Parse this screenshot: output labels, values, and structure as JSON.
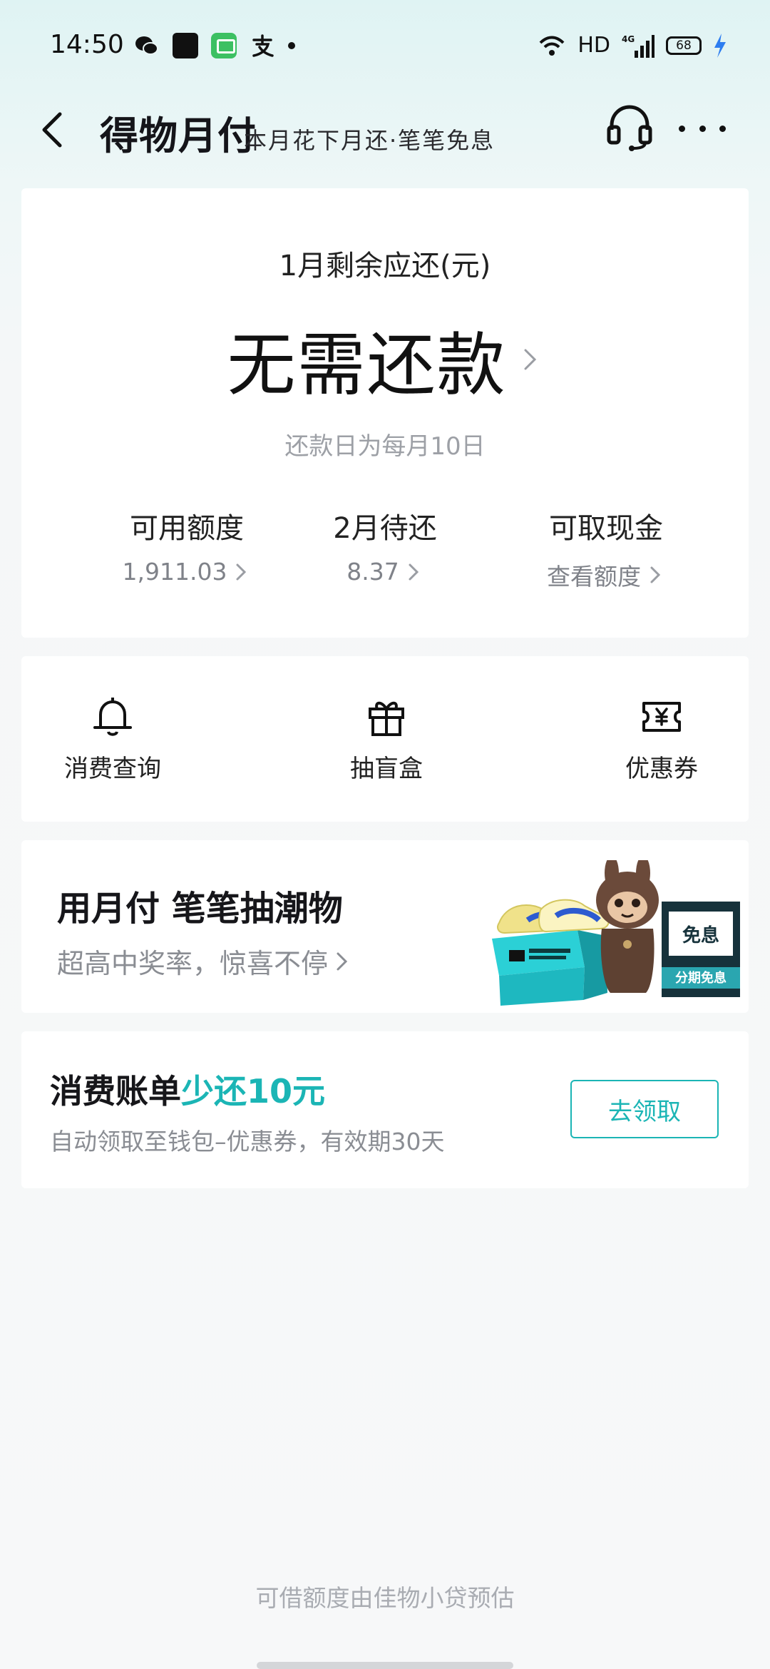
{
  "status_bar": {
    "time": "14:50",
    "left_icons": [
      "wechat-icon",
      "black-app-icon",
      "messages-icon",
      "alipay-icon",
      "dot-icon"
    ],
    "network": "HD",
    "signal": "4G",
    "battery": "68"
  },
  "nav": {
    "brand": "得物月付",
    "subtitle": "本月花下月还·笔笔免息"
  },
  "summary": {
    "label": "1月剩余应还(元)",
    "amount": "无需还款",
    "due_note": "还款日为每月10日",
    "stats": [
      {
        "label": "可用额度",
        "value": "1,911.03"
      },
      {
        "label": "2月待还",
        "value": "8.37"
      },
      {
        "label": "可取现金",
        "value": "查看额度"
      }
    ]
  },
  "actions": [
    {
      "label": "消费查询",
      "icon": "bell-icon"
    },
    {
      "label": "抽盲盒",
      "icon": "gift-icon"
    },
    {
      "label": "优惠券",
      "icon": "coupon-icon"
    }
  ],
  "promo": {
    "title": "用月付 笔笔抽潮物",
    "subtitle": "超高中奖率，惊喜不停",
    "art_sign": "免息",
    "art_banner": "分期免息"
  },
  "bill": {
    "title_prefix": "消费账单",
    "title_accent": "少还10元",
    "subtitle": "自动领取至钱包–优惠券，有效期30天",
    "button": "去领取"
  },
  "footer": {
    "note": "可借额度由佳物小贷预估"
  },
  "colors": {
    "accent": "#1bb5b5",
    "header_bg": "#dff3f3",
    "muted_text": "#8a8d93"
  }
}
